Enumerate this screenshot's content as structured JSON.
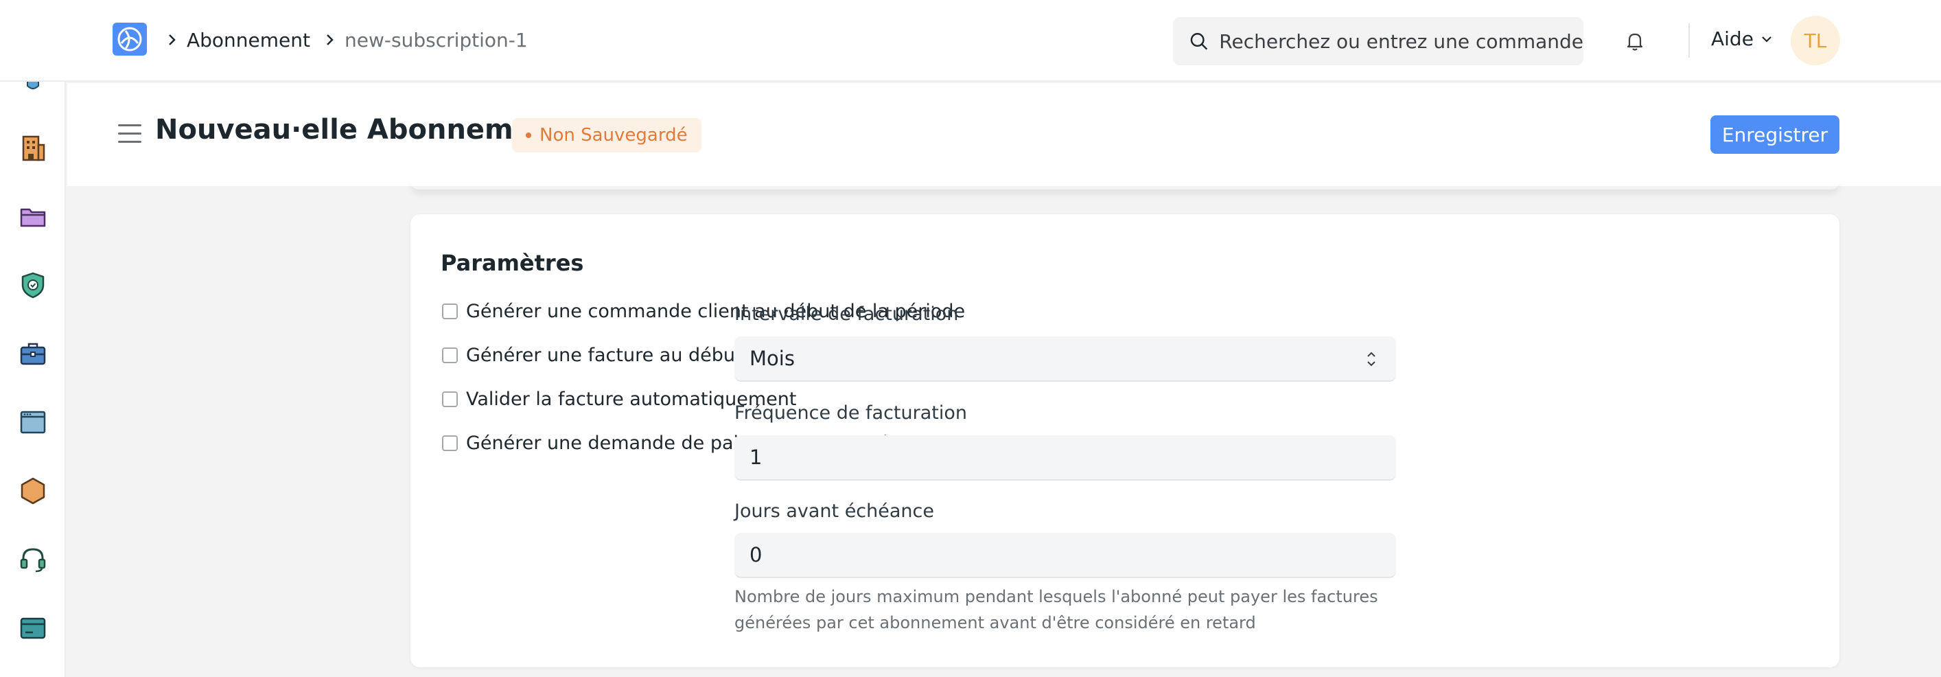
{
  "breadcrumb": {
    "items": [
      "Abonnement",
      "new-subscription-1"
    ]
  },
  "search": {
    "placeholder": "Recherchez ou entrez une commande"
  },
  "navbar": {
    "help_label": "Aide",
    "avatar_initials": "TL"
  },
  "sidebar": {
    "icons": [
      "building-icon",
      "folder-icon",
      "shield-check-icon",
      "briefcase-icon",
      "window-icon",
      "hexagon-icon",
      "headset-icon",
      "card-icon"
    ]
  },
  "page": {
    "title": "Nouveau·elle Abonnement",
    "status_badge": "Non Sauvegardé",
    "save_label": "Enregistrer"
  },
  "settings": {
    "title": "Paramètres",
    "checkboxes": [
      {
        "label": "Générer une commande client au début de la période",
        "checked": false
      },
      {
        "label": "Générer une facture au début de la période",
        "checked": false
      },
      {
        "label": "Valider la facture automatiquement",
        "checked": false
      },
      {
        "label": "Générer une demande de paiement automatiquement",
        "checked": false
      }
    ],
    "billing_interval": {
      "label": "Intervalle de facturation",
      "value": "Mois"
    },
    "billing_frequency": {
      "label": "Fréquence de facturation",
      "value": "1"
    },
    "days_until_due": {
      "label": "Jours avant échéance",
      "value": "0",
      "help": "Nombre de jours maximum pendant lesquels l'abonné peut payer les factures générées par cet abonnement avant d'être considéré en retard"
    }
  },
  "colors": {
    "accent": "#4f8ef7",
    "badge_text": "#e07b39",
    "badge_bg": "#fdf1e6"
  }
}
